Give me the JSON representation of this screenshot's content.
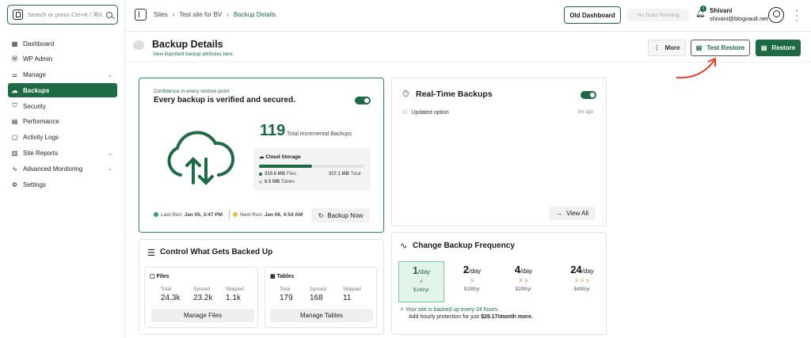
{
  "search": {
    "placeholder": "Search or press Ctrl+K / ⌘K"
  },
  "sidebar": {
    "items": [
      {
        "label": "Dashboard",
        "icon": "grid-icon"
      },
      {
        "label": "WP Admin",
        "icon": "wordpress-icon"
      },
      {
        "label": "Manage",
        "icon": "sliders-icon",
        "chevron": true
      },
      {
        "label": "Backups",
        "icon": "cloud-icon",
        "active": true
      },
      {
        "label": "Security",
        "icon": "shield-icon"
      },
      {
        "label": "Performance",
        "icon": "document-icon"
      },
      {
        "label": "Activity Logs",
        "icon": "clipboard-icon"
      },
      {
        "label": "Site Reports",
        "icon": "report-icon",
        "chevron": true
      },
      {
        "label": "Advanced Monitoring",
        "icon": "pulse-icon",
        "chevron": true
      },
      {
        "label": "Settings",
        "icon": "gear-icon"
      }
    ]
  },
  "breadcrumb": {
    "sites": "Sites",
    "site": "Test site for BV",
    "current": "Backup Details"
  },
  "topbar": {
    "old_dashboard": "Old Dashboard",
    "tasks": "No Tasks Running",
    "notif_count": "1",
    "user_name": "Shivani",
    "user_email": "shivani@blogvault.net"
  },
  "header": {
    "title": "Backup Details",
    "subtitle": "View important backup attributes here.",
    "more": "More",
    "test_restore": "Test Restore",
    "restore": "Restore"
  },
  "verify": {
    "kicker": "Confidence in every restore point",
    "title": "Every backup is verified and secured.",
    "count": "119",
    "count_label": "Total Incremental Backups",
    "storage_title": "Cloud Storage",
    "storage_used_fraction": 0.5,
    "files_size": "310.6 MB",
    "files_label": "Files",
    "total_size": "317.1 MB",
    "total_label": "Total",
    "tables_size": "6.5 MB",
    "tables_label": "Tables",
    "last_run_label": "Last Run:",
    "last_run": "Jan 05, 3:47 PM",
    "next_run_label": "Next Run:",
    "next_run": "Jan 06, 4:54 AM",
    "backup_now": "Backup Now",
    "success_color": "#2fa35f",
    "pending_color": "#f2b74a"
  },
  "realtime": {
    "title": "Real-Time Backups",
    "item": "Updated option",
    "item_time": "2m ago",
    "view_all": "View All"
  },
  "control": {
    "title": "Control What Gets Backed Up",
    "files": {
      "title": "Files",
      "total_label": "Total",
      "total": "24.3k",
      "synced_label": "Synced",
      "synced": "23.2k",
      "skipped_label": "Skipped",
      "skipped": "1.1k",
      "button": "Manage Files"
    },
    "tables": {
      "title": "Tables",
      "total_label": "Total",
      "total": "179",
      "synced_label": "Synced",
      "synced": "168",
      "skipped_label": "Skipped",
      "skipped": "11",
      "button": "Manage Tables"
    }
  },
  "frequency": {
    "title": "Change Backup Frequency",
    "options": [
      {
        "n": "1",
        "unit": "/day",
        "price": "$149/yr"
      },
      {
        "n": "2",
        "unit": "/day",
        "price": "$199/yr"
      },
      {
        "n": "4",
        "unit": "/day",
        "price": "$299/yr"
      },
      {
        "n": "24",
        "unit": "/day",
        "price": "$499/yr"
      }
    ],
    "note": "Your site is backed up every 24 hours.",
    "upsell_prefix": "Add hourly protection for just",
    "upsell_price": "$29.17/month more."
  },
  "colors": {
    "brand": "#1d6a44",
    "annotation": "#e2402b"
  }
}
